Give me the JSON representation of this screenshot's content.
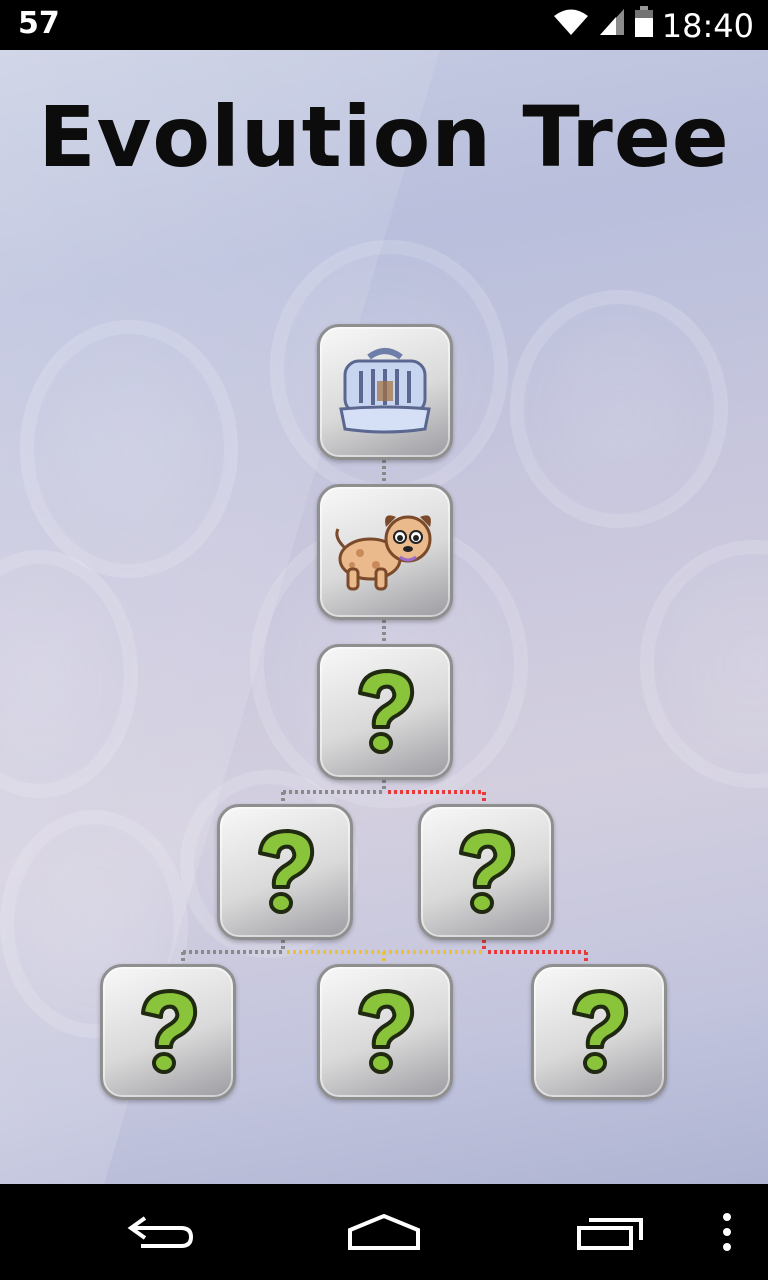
{
  "status_bar": {
    "left_text": "57",
    "time": "18:40",
    "icons": [
      "wifi-icon",
      "signal-icon",
      "battery-icon"
    ]
  },
  "screen": {
    "title": "Evolution Tree"
  },
  "tree": {
    "nodes": [
      {
        "id": "root",
        "state": "unlocked",
        "icon": "pet-carrier-icon"
      },
      {
        "id": "level-2",
        "state": "unlocked",
        "icon": "puppy-icon"
      },
      {
        "id": "level-3",
        "state": "locked",
        "icon": "question-mark-icon"
      },
      {
        "id": "level-4-left",
        "state": "locked",
        "icon": "question-mark-icon"
      },
      {
        "id": "level-4-right",
        "state": "locked",
        "icon": "question-mark-icon"
      },
      {
        "id": "level-5-left",
        "state": "locked",
        "icon": "question-mark-icon"
      },
      {
        "id": "level-5-middle",
        "state": "locked",
        "icon": "question-mark-icon"
      },
      {
        "id": "level-5-right",
        "state": "locked",
        "icon": "question-mark-icon"
      }
    ],
    "connector_colors": {
      "gray": "#8a8a8a",
      "red": "#e83a3a",
      "yellow": "#e8c23a"
    }
  },
  "nav_bar": {
    "buttons": [
      "back-icon",
      "home-icon",
      "recent-apps-icon",
      "menu-overflow-icon"
    ]
  }
}
